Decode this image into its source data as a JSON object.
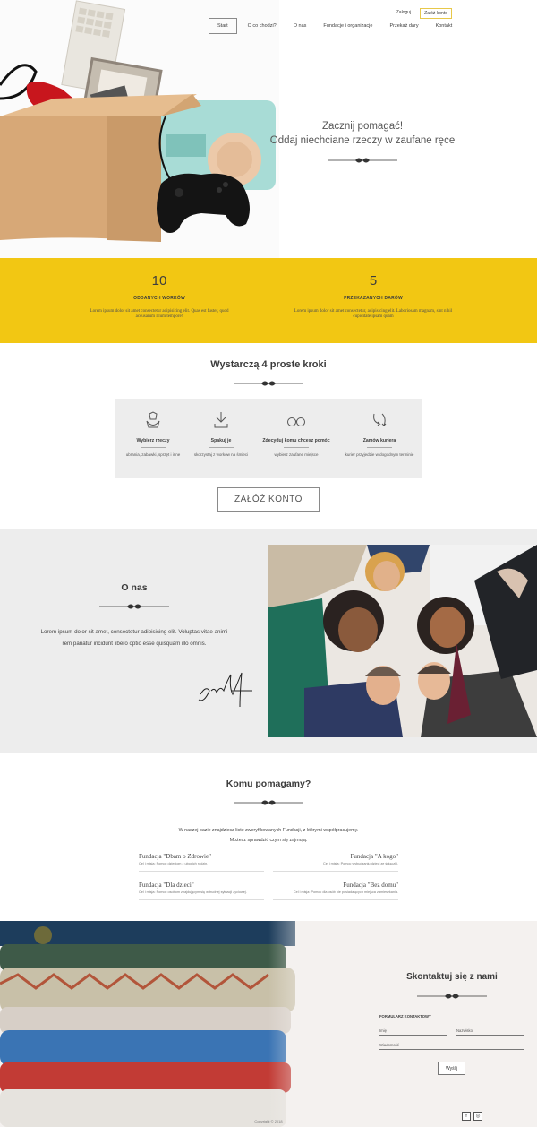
{
  "header": {
    "login": "Zaloguj",
    "register": "Załóż konto",
    "nav": [
      "Start",
      "O co chodzi?",
      "O nas",
      "Fundacje i organizacje",
      "Przekaż dary",
      "Kontakt"
    ]
  },
  "hero": {
    "line1": "Zacznij pomagać!",
    "line2": "Oddaj niechciane rzeczy w zaufane ręce"
  },
  "stats": [
    {
      "number": "10",
      "label": "ODDANYCH WORKÓW",
      "desc_line1": "Lorem ipsum dolor sit amet consectetur adipisicing elit. Quas est fuster, quod",
      "desc_line2": "accusarum Illum tempore!"
    },
    {
      "number": "5",
      "label": "PRZEKAZANYCH DARÓW",
      "desc_line1": "Lorem ipsum dolor sit amet consectetur, adipisicing elit. Laboriosam magnam, sint nihil",
      "desc_line2": "cupiditate ipsam quam"
    }
  ],
  "steps": {
    "title": "Wystarczą 4 proste kroki",
    "items": [
      {
        "icon": "hand-shirt-icon",
        "title": "Wybierz rzeczy",
        "desc": "ubrania, zabawki, sprzęt i inne"
      },
      {
        "icon": "download-icon",
        "title": "Spakuj je",
        "desc": "skorzystaj z worków na śmieci"
      },
      {
        "icon": "binoculars-icon",
        "title": "Zdecyduj komu chcesz pomóc",
        "desc": "wybierz zaufane miejsce"
      },
      {
        "icon": "arrows-cycle-icon",
        "title": "Zamów kuriera",
        "desc": "kurier przyjedzie w dogodnym terminie"
      }
    ],
    "button": "ZAŁÓŻ KONTO"
  },
  "about": {
    "title": "O nas",
    "text": "Lorem ipsum dolor sit amet, consectetur adipisicing elit. Voluptas vitae animi rem pariatur incidunt libero optio esse quisquam illo omnis."
  },
  "help": {
    "title": "Komu pomagamy?",
    "intro": "W naszej bazie znajdziesz listę zweryfikowanych Fundacji, z którymi współpracujemy. Możesz sprawdzić czym się zajmują.",
    "orgs": [
      {
        "name": "Fundacja \"Dbam o Zdrowie\"",
        "desc": "Cel i misja: Pomoc dzieciom z ubogich rodzin."
      },
      {
        "name": "Fundacja \"A kogo\"",
        "desc": "Cel i misja: Pomoc wybudzaniu dzieci ze śpiączki."
      },
      {
        "name": "Fundacja \"Dla dzieci\"",
        "desc": "Cel i misja: Pomoc osobom znajdującym się w trudnej sytuacji życiowej."
      },
      {
        "name": "Fundacja \"Bez domu\"",
        "desc": "Cel i misja: Pomoc dla osób nie posiadających miejsca zamieszkania."
      }
    ]
  },
  "contact": {
    "title": "Skontaktuj się z nami",
    "form_label": "FORMULARZ KONTAKTOWY",
    "name_placeholder": "Imię",
    "surname_placeholder": "Nazwisko",
    "message_placeholder": "Wiadomość",
    "send": "Wyślij",
    "copyright": "Copyright © 2018",
    "social": [
      "f",
      "◎"
    ]
  },
  "colors": {
    "accent": "#f2c713",
    "gray_band": "#ededed"
  }
}
